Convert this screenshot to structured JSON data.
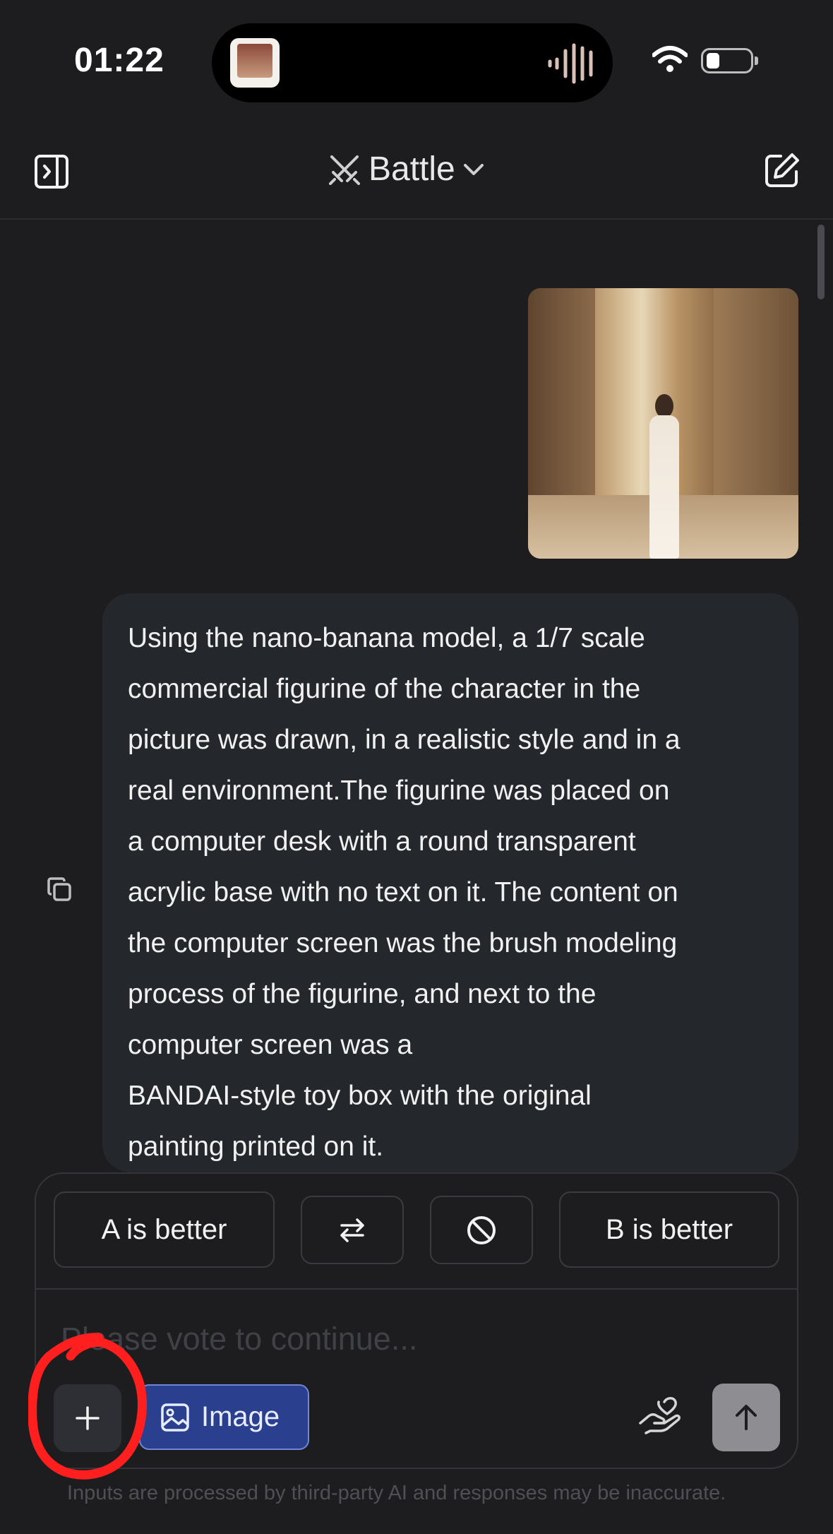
{
  "status_bar": {
    "time": "01:22"
  },
  "header": {
    "title": "Battle"
  },
  "message": {
    "text": "Using the nano-banana model, a 1/7 scale\ncommercial figurine of the character in the\npicture was drawn, in a realistic style and in a\nreal environment.The figurine was placed on\na computer desk with a round transparent\nacrylic base with no text on it. The content on\nthe computer screen was the brush modeling\nprocess of the figurine, and next to the\ncomputer screen was a\nBANDAI-style toy box with the original\npainting printed on it."
  },
  "vote": {
    "a_label": "A is better",
    "b_label": "B is better"
  },
  "composer": {
    "placeholder": "Please vote to continue...",
    "image_label": "Image"
  },
  "footer": {
    "disclaimer": "Inputs are processed by third-party AI and responses may be inaccurate."
  },
  "colors": {
    "background": "#1d1d20",
    "bubble": "#24272b",
    "image_button": "#2a3f8d",
    "send_button": "#8e8e92",
    "annotation": "#ff2020"
  },
  "icons": [
    "sidebar-toggle-icon",
    "swords-icon",
    "chevron-down-icon",
    "new-chat-icon",
    "copy-icon",
    "swap-icon",
    "no-icon",
    "plus-icon",
    "image-icon",
    "hand-heart-icon",
    "arrow-up-icon"
  ]
}
